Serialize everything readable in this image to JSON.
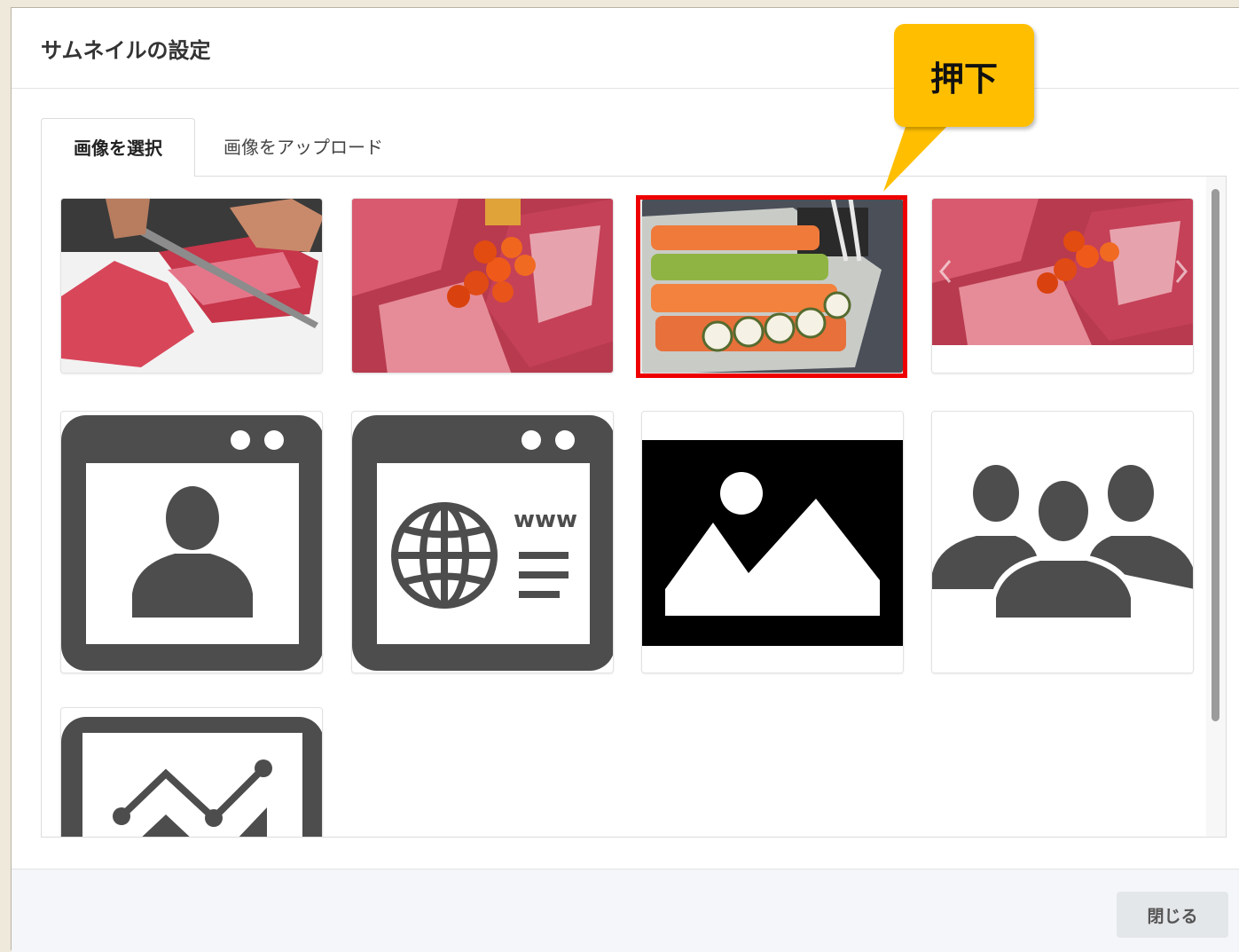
{
  "modal": {
    "title": "サムネイルの設定",
    "tabs": [
      {
        "label": "画像を選択",
        "active": true
      },
      {
        "label": "画像をアップロード",
        "active": false
      }
    ],
    "thumbnails": [
      {
        "kind": "photo",
        "subject": "meat-slicing"
      },
      {
        "kind": "photo",
        "subject": "beef-with-ikura"
      },
      {
        "kind": "photo",
        "subject": "sushi-rolls",
        "selected": true
      },
      {
        "kind": "photo",
        "subject": "beef-with-ikura-carousel"
      },
      {
        "kind": "icon",
        "subject": "profile-window-icon"
      },
      {
        "kind": "icon",
        "subject": "website-window-icon",
        "text": "www"
      },
      {
        "kind": "icon",
        "subject": "image-placeholder-icon"
      },
      {
        "kind": "icon",
        "subject": "group-users-icon"
      },
      {
        "kind": "icon",
        "subject": "chart-window-icon"
      }
    ],
    "close_label": "閉じる"
  },
  "callout": {
    "text": "押下",
    "color": "#ffbf00"
  },
  "colors": {
    "selection_outline": "#ee0000",
    "icon_gray": "#4d4d4d"
  }
}
